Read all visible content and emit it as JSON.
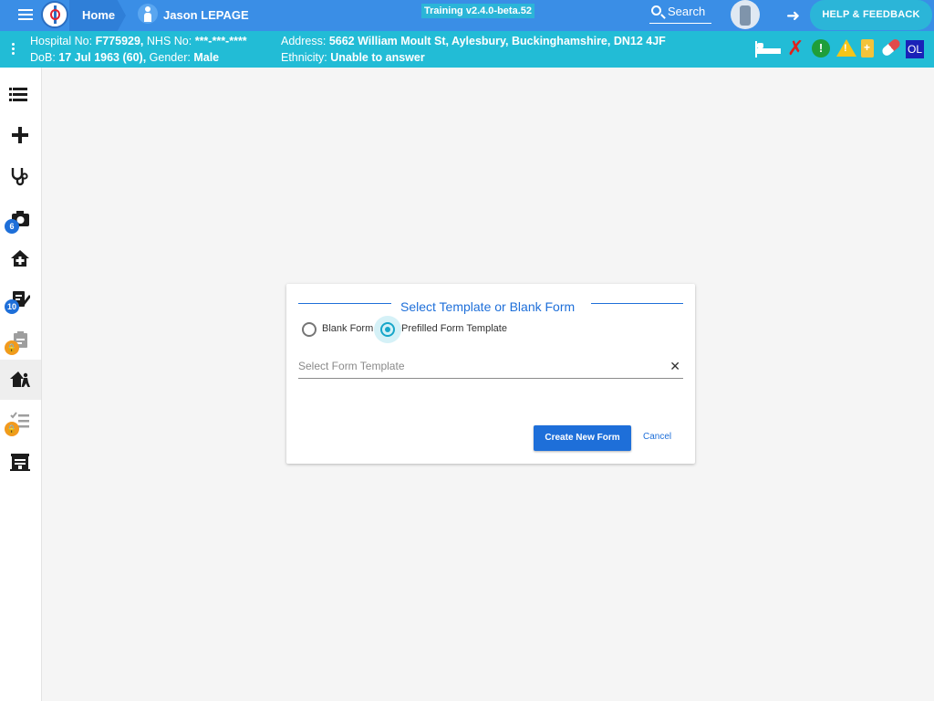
{
  "topbar": {
    "home_label": "Home",
    "patient_name": "Jason LEPAGE",
    "version": "Training v2.4.0-beta.52",
    "search_label": "Search",
    "help_label": "HELP & FEEDBACK"
  },
  "banner": {
    "hospital_no_label": "Hospital No:",
    "hospital_no": "F775929,",
    "nhs_no_label": "NHS No:",
    "nhs_no": "***-***-****",
    "dob_label": "DoB:",
    "dob": "17 Jul 1963 (60),",
    "gender_label": "Gender:",
    "gender": "Male",
    "address_label": "Address:",
    "address": "5662 William Moult St, Aylesbury, Buckinghamshire, DN12 4JF",
    "ethnicity_label": "Ethnicity:",
    "ethnicity": "Unable to answer",
    "ol_label": "OL"
  },
  "sidebar": {
    "badges": {
      "camera": "6",
      "notes": "10"
    }
  },
  "dialog": {
    "title": "Select Template or Blank Form",
    "option_blank": "Blank Form",
    "option_prefilled": "Prefilled Form Template",
    "selected_option": "Prefilled Form Template",
    "template_placeholder": "Select Form Template",
    "create_label": "Create New Form",
    "cancel_label": "Cancel"
  },
  "colors": {
    "topbar": "#3a8ee6",
    "banner": "#22bcd6",
    "primary": "#1e6fd9",
    "radio_accent": "#17a6c9"
  }
}
